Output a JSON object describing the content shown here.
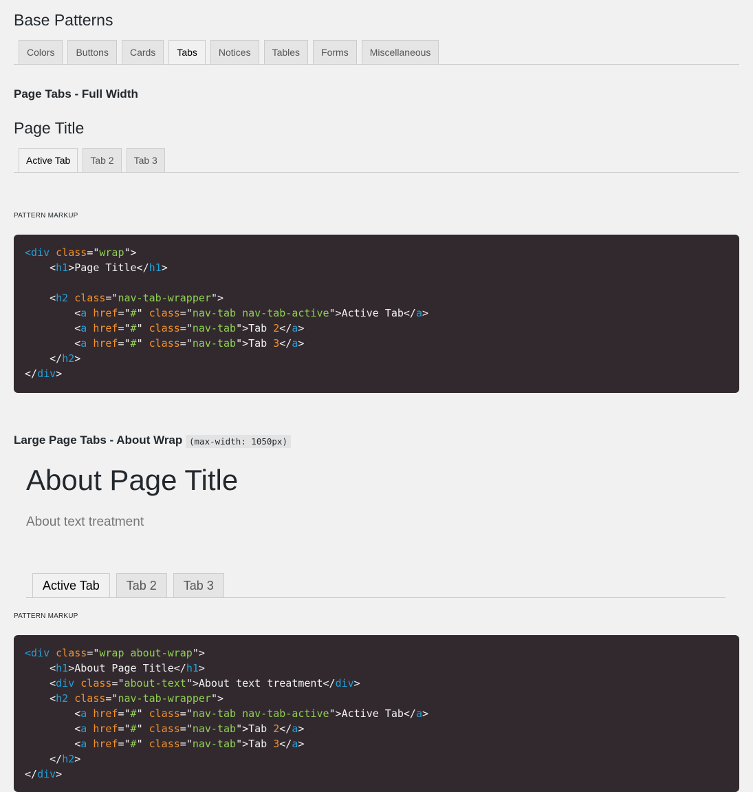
{
  "page_title": "Base Patterns",
  "base_tabs": [
    "Colors",
    "Buttons",
    "Cards",
    "Tabs",
    "Notices",
    "Tables",
    "Forms",
    "Miscellaneous"
  ],
  "active_base_tab": "Tabs",
  "section1": {
    "title": "Page Tabs - Full Width",
    "demo_title": "Page Title",
    "tabs": [
      "Active Tab",
      "Tab 2",
      "Tab 3"
    ],
    "markup_label": "PATTERN MARKUP"
  },
  "code1": [
    [
      [
        "tg",
        "<"
      ],
      [
        "tg",
        "div"
      ],
      [
        "tx",
        " "
      ],
      [
        "at",
        "class"
      ],
      [
        "tx",
        "=\""
      ],
      [
        "st",
        "wrap"
      ],
      [
        "tx",
        "\">"
      ]
    ],
    [
      [
        "tx",
        "    <"
      ],
      [
        "tg",
        "h1"
      ],
      [
        "tx",
        ">Page Title</"
      ],
      [
        "tg",
        "h1"
      ],
      [
        "tx",
        ">"
      ]
    ],
    [],
    [
      [
        "tx",
        "    <"
      ],
      [
        "tg",
        "h2"
      ],
      [
        "tx",
        " "
      ],
      [
        "at",
        "class"
      ],
      [
        "tx",
        "=\""
      ],
      [
        "st",
        "nav-tab-wrapper"
      ],
      [
        "tx",
        "\">"
      ]
    ],
    [
      [
        "tx",
        "        <"
      ],
      [
        "tg",
        "a"
      ],
      [
        "tx",
        " "
      ],
      [
        "at",
        "href"
      ],
      [
        "tx",
        "=\""
      ],
      [
        "st",
        "#"
      ],
      [
        "tx",
        "\" "
      ],
      [
        "at",
        "class"
      ],
      [
        "tx",
        "=\""
      ],
      [
        "st",
        "nav-tab nav-tab-active"
      ],
      [
        "tx",
        "\">Active Tab</"
      ],
      [
        "tg",
        "a"
      ],
      [
        "tx",
        ">"
      ]
    ],
    [
      [
        "tx",
        "        <"
      ],
      [
        "tg",
        "a"
      ],
      [
        "tx",
        " "
      ],
      [
        "at",
        "href"
      ],
      [
        "tx",
        "=\""
      ],
      [
        "st",
        "#"
      ],
      [
        "tx",
        "\" "
      ],
      [
        "at",
        "class"
      ],
      [
        "tx",
        "=\""
      ],
      [
        "st",
        "nav-tab"
      ],
      [
        "tx",
        "\">Tab "
      ],
      [
        "nm",
        "2"
      ],
      [
        "tx",
        "</"
      ],
      [
        "tg",
        "a"
      ],
      [
        "tx",
        ">"
      ]
    ],
    [
      [
        "tx",
        "        <"
      ],
      [
        "tg",
        "a"
      ],
      [
        "tx",
        " "
      ],
      [
        "at",
        "href"
      ],
      [
        "tx",
        "=\""
      ],
      [
        "st",
        "#"
      ],
      [
        "tx",
        "\" "
      ],
      [
        "at",
        "class"
      ],
      [
        "tx",
        "=\""
      ],
      [
        "st",
        "nav-tab"
      ],
      [
        "tx",
        "\">Tab "
      ],
      [
        "nm",
        "3"
      ],
      [
        "tx",
        "</"
      ],
      [
        "tg",
        "a"
      ],
      [
        "tx",
        ">"
      ]
    ],
    [
      [
        "tx",
        "    </"
      ],
      [
        "tg",
        "h2"
      ],
      [
        "tx",
        ">"
      ]
    ],
    [
      [
        "tx",
        "</"
      ],
      [
        "tg",
        "div"
      ],
      [
        "tx",
        ">"
      ]
    ]
  ],
  "section2": {
    "title": "Large Page Tabs - About Wrap",
    "note": "(max-width: 1050px)",
    "about_title": "About Page Title",
    "about_text": "About text treatment",
    "tabs": [
      "Active Tab",
      "Tab 2",
      "Tab 3"
    ],
    "markup_label": "PATTERN MARKUP"
  },
  "code2": [
    [
      [
        "tg",
        "<"
      ],
      [
        "tg",
        "div"
      ],
      [
        "tx",
        " "
      ],
      [
        "at",
        "class"
      ],
      [
        "tx",
        "=\""
      ],
      [
        "st",
        "wrap about-wrap"
      ],
      [
        "tx",
        "\">"
      ]
    ],
    [
      [
        "tx",
        "    <"
      ],
      [
        "tg",
        "h1"
      ],
      [
        "tx",
        ">About Page Title</"
      ],
      [
        "tg",
        "h1"
      ],
      [
        "tx",
        ">"
      ]
    ],
    [
      [
        "tx",
        "    <"
      ],
      [
        "tg",
        "div"
      ],
      [
        "tx",
        " "
      ],
      [
        "at",
        "class"
      ],
      [
        "tx",
        "=\""
      ],
      [
        "st",
        "about-text"
      ],
      [
        "tx",
        "\">About text treatment</"
      ],
      [
        "tg",
        "div"
      ],
      [
        "tx",
        ">"
      ]
    ],
    [
      [
        "tx",
        "    <"
      ],
      [
        "tg",
        "h2"
      ],
      [
        "tx",
        " "
      ],
      [
        "at",
        "class"
      ],
      [
        "tx",
        "=\""
      ],
      [
        "st",
        "nav-tab-wrapper"
      ],
      [
        "tx",
        "\">"
      ]
    ],
    [
      [
        "tx",
        "        <"
      ],
      [
        "tg",
        "a"
      ],
      [
        "tx",
        " "
      ],
      [
        "at",
        "href"
      ],
      [
        "tx",
        "=\""
      ],
      [
        "st",
        "#"
      ],
      [
        "tx",
        "\" "
      ],
      [
        "at",
        "class"
      ],
      [
        "tx",
        "=\""
      ],
      [
        "st",
        "nav-tab nav-tab-active"
      ],
      [
        "tx",
        "\">Active Tab</"
      ],
      [
        "tg",
        "a"
      ],
      [
        "tx",
        ">"
      ]
    ],
    [
      [
        "tx",
        "        <"
      ],
      [
        "tg",
        "a"
      ],
      [
        "tx",
        " "
      ],
      [
        "at",
        "href"
      ],
      [
        "tx",
        "=\""
      ],
      [
        "st",
        "#"
      ],
      [
        "tx",
        "\" "
      ],
      [
        "at",
        "class"
      ],
      [
        "tx",
        "=\""
      ],
      [
        "st",
        "nav-tab"
      ],
      [
        "tx",
        "\">Tab "
      ],
      [
        "nm",
        "2"
      ],
      [
        "tx",
        "</"
      ],
      [
        "tg",
        "a"
      ],
      [
        "tx",
        ">"
      ]
    ],
    [
      [
        "tx",
        "        <"
      ],
      [
        "tg",
        "a"
      ],
      [
        "tx",
        " "
      ],
      [
        "at",
        "href"
      ],
      [
        "tx",
        "=\""
      ],
      [
        "st",
        "#"
      ],
      [
        "tx",
        "\" "
      ],
      [
        "at",
        "class"
      ],
      [
        "tx",
        "=\""
      ],
      [
        "st",
        "nav-tab"
      ],
      [
        "tx",
        "\">Tab "
      ],
      [
        "nm",
        "3"
      ],
      [
        "tx",
        "</"
      ],
      [
        "tg",
        "a"
      ],
      [
        "tx",
        ">"
      ]
    ],
    [
      [
        "tx",
        "    </"
      ],
      [
        "tg",
        "h2"
      ],
      [
        "tx",
        ">"
      ]
    ],
    [
      [
        "tx",
        "</"
      ],
      [
        "tg",
        "div"
      ],
      [
        "tx",
        ">"
      ]
    ]
  ]
}
